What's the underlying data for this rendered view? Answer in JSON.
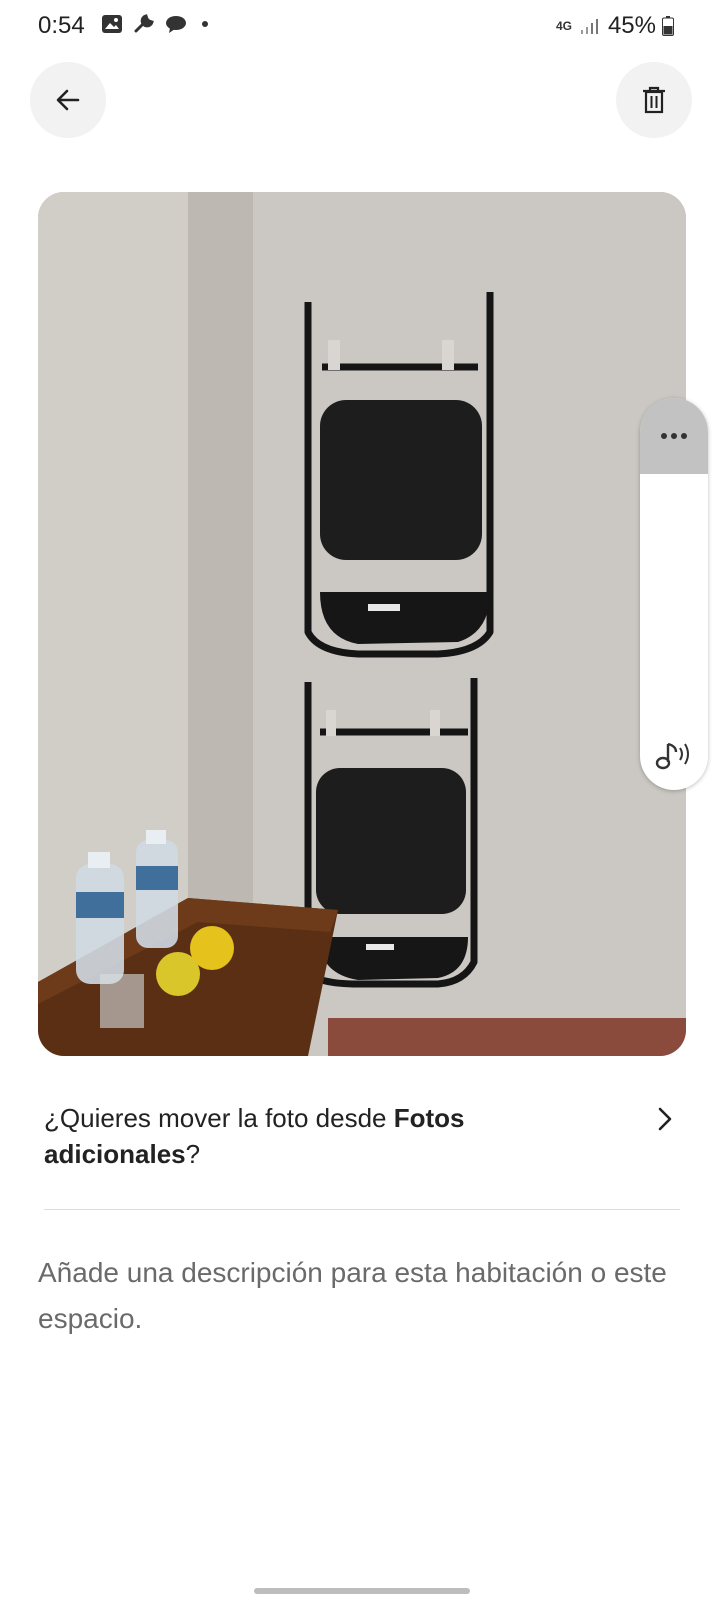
{
  "status_bar": {
    "time": "0:54",
    "network_type": "4G",
    "battery_percent": "45%",
    "left_icons": [
      "gallery-icon",
      "wrench-icon",
      "chat-bubble-icon",
      "dot-icon"
    ],
    "right_icons": [
      "network-4g-icon",
      "signal-icon",
      "battery-icon"
    ]
  },
  "header": {
    "back_icon": "arrow-left-icon",
    "delete_icon": "trash-icon"
  },
  "photo": {
    "description_icon": "photo"
  },
  "floating_panel": {
    "more_icon": "more-horizontal-icon",
    "sound_icon": "sound-recognition-icon"
  },
  "move_prompt": {
    "prefix": "¿Quieres mover la foto desde ",
    "bold": "Fotos adicionales",
    "suffix": "?"
  },
  "description_placeholder": "Añade una descripción para esta habitación o este espacio.",
  "colors": {
    "text_primary": "#222222",
    "text_secondary": "#6a6a6a",
    "button_bg": "#f2f2f2",
    "divider": "#dddddd"
  }
}
